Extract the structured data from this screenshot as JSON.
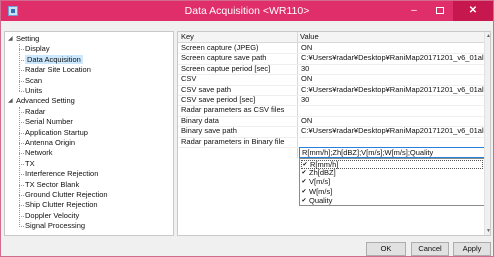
{
  "window": {
    "title": "Data Acquisition <WR110>",
    "minimize_glyph": "–",
    "close_glyph": "✕"
  },
  "tree": {
    "groups": [
      {
        "label": "Setting",
        "children": [
          "Display",
          "Data Acquisition",
          "Radar Site Location",
          "Scan",
          "Units"
        ],
        "selected": 1
      },
      {
        "label": "Advanced Setting",
        "children": [
          "Radar",
          "Serial Number",
          "Application Startup",
          "Antenna Origin",
          "Network",
          "TX",
          "Interference Rejection",
          "TX Sector Blank",
          "Ground Clutter Rejection",
          "Ship Clutter Rejection",
          "Doppler Velocity",
          "Signal Processing"
        ]
      }
    ],
    "expand_glyph": "◢"
  },
  "grid": {
    "headers": {
      "key": "Key",
      "value": "Value"
    },
    "rows": [
      {
        "key": "Screen capture (JPEG)",
        "value": "ON"
      },
      {
        "key": "Screen capture save path",
        "value": "C:¥Users¥radar¥Desktop¥RaniMap20171201_v6_01alph"
      },
      {
        "key": "Screen captue period [sec]",
        "value": "30"
      },
      {
        "key": "CSV",
        "value": "ON"
      },
      {
        "key": "CSV save path",
        "value": "C:¥Users¥radar¥Desktop¥RaniMap20171201_v6_01alph"
      },
      {
        "key": "CSV save period [sec]",
        "value": "30"
      },
      {
        "key": "Radar parameters as CSV files",
        "value": ""
      },
      {
        "key": "Binary data",
        "value": "ON"
      },
      {
        "key": "Binary save path",
        "value": "C:¥Users¥radar¥Desktop¥RaniMap20171201_v6_01alph"
      },
      {
        "key": "Radar parameters in Binary file",
        "value": "R[mm/h];Zh[dBZ];V[m/s];W[m/s];Quality"
      }
    ],
    "dropdown_items": [
      {
        "label": "R[mm/h]",
        "checked": true
      },
      {
        "label": "Zh[dBZ]",
        "checked": true
      },
      {
        "label": "V[m/s]",
        "checked": true
      },
      {
        "label": "W[m/s]",
        "checked": true
      },
      {
        "label": "Quality",
        "checked": true
      }
    ],
    "check_glyph": "✔"
  },
  "buttons": {
    "ok": "OK",
    "cancel": "Cancel",
    "apply": "Apply"
  },
  "colors": {
    "titlebar": "#e02e6b",
    "close": "#c7174f",
    "selection": "#cce8ff",
    "focus": "#2a80d8"
  }
}
